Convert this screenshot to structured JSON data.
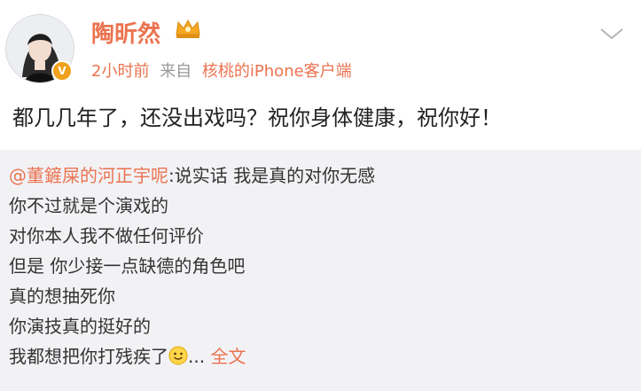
{
  "user": {
    "name": "陶昕然",
    "verified_icon": "verified-badge-icon",
    "vip_icon": "crown-icon"
  },
  "meta": {
    "time": "2小时前",
    "from_label": "来自",
    "source": "核桃的iPhone客户端"
  },
  "post": {
    "text": "都几几年了，还没出戏吗？祝你身体健康，祝你好！"
  },
  "repost": {
    "mention": "@董鏟屎的河正宇呢",
    "first_line_rest": ":说实话 我是真的对你无感",
    "lines": [
      "你不过就是个演戏的",
      "对你本人我不做任何评价",
      "但是 你少接一点缺德的角色吧",
      "真的想抽死你",
      "你演技真的挺好的"
    ],
    "last_line_text": "我都想把你打残疾了",
    "ellipsis": "...",
    "more_label": "全文"
  },
  "colors": {
    "accent": "#eb7350",
    "meta_gray": "#999999",
    "repost_bg": "#f2f2f5"
  }
}
